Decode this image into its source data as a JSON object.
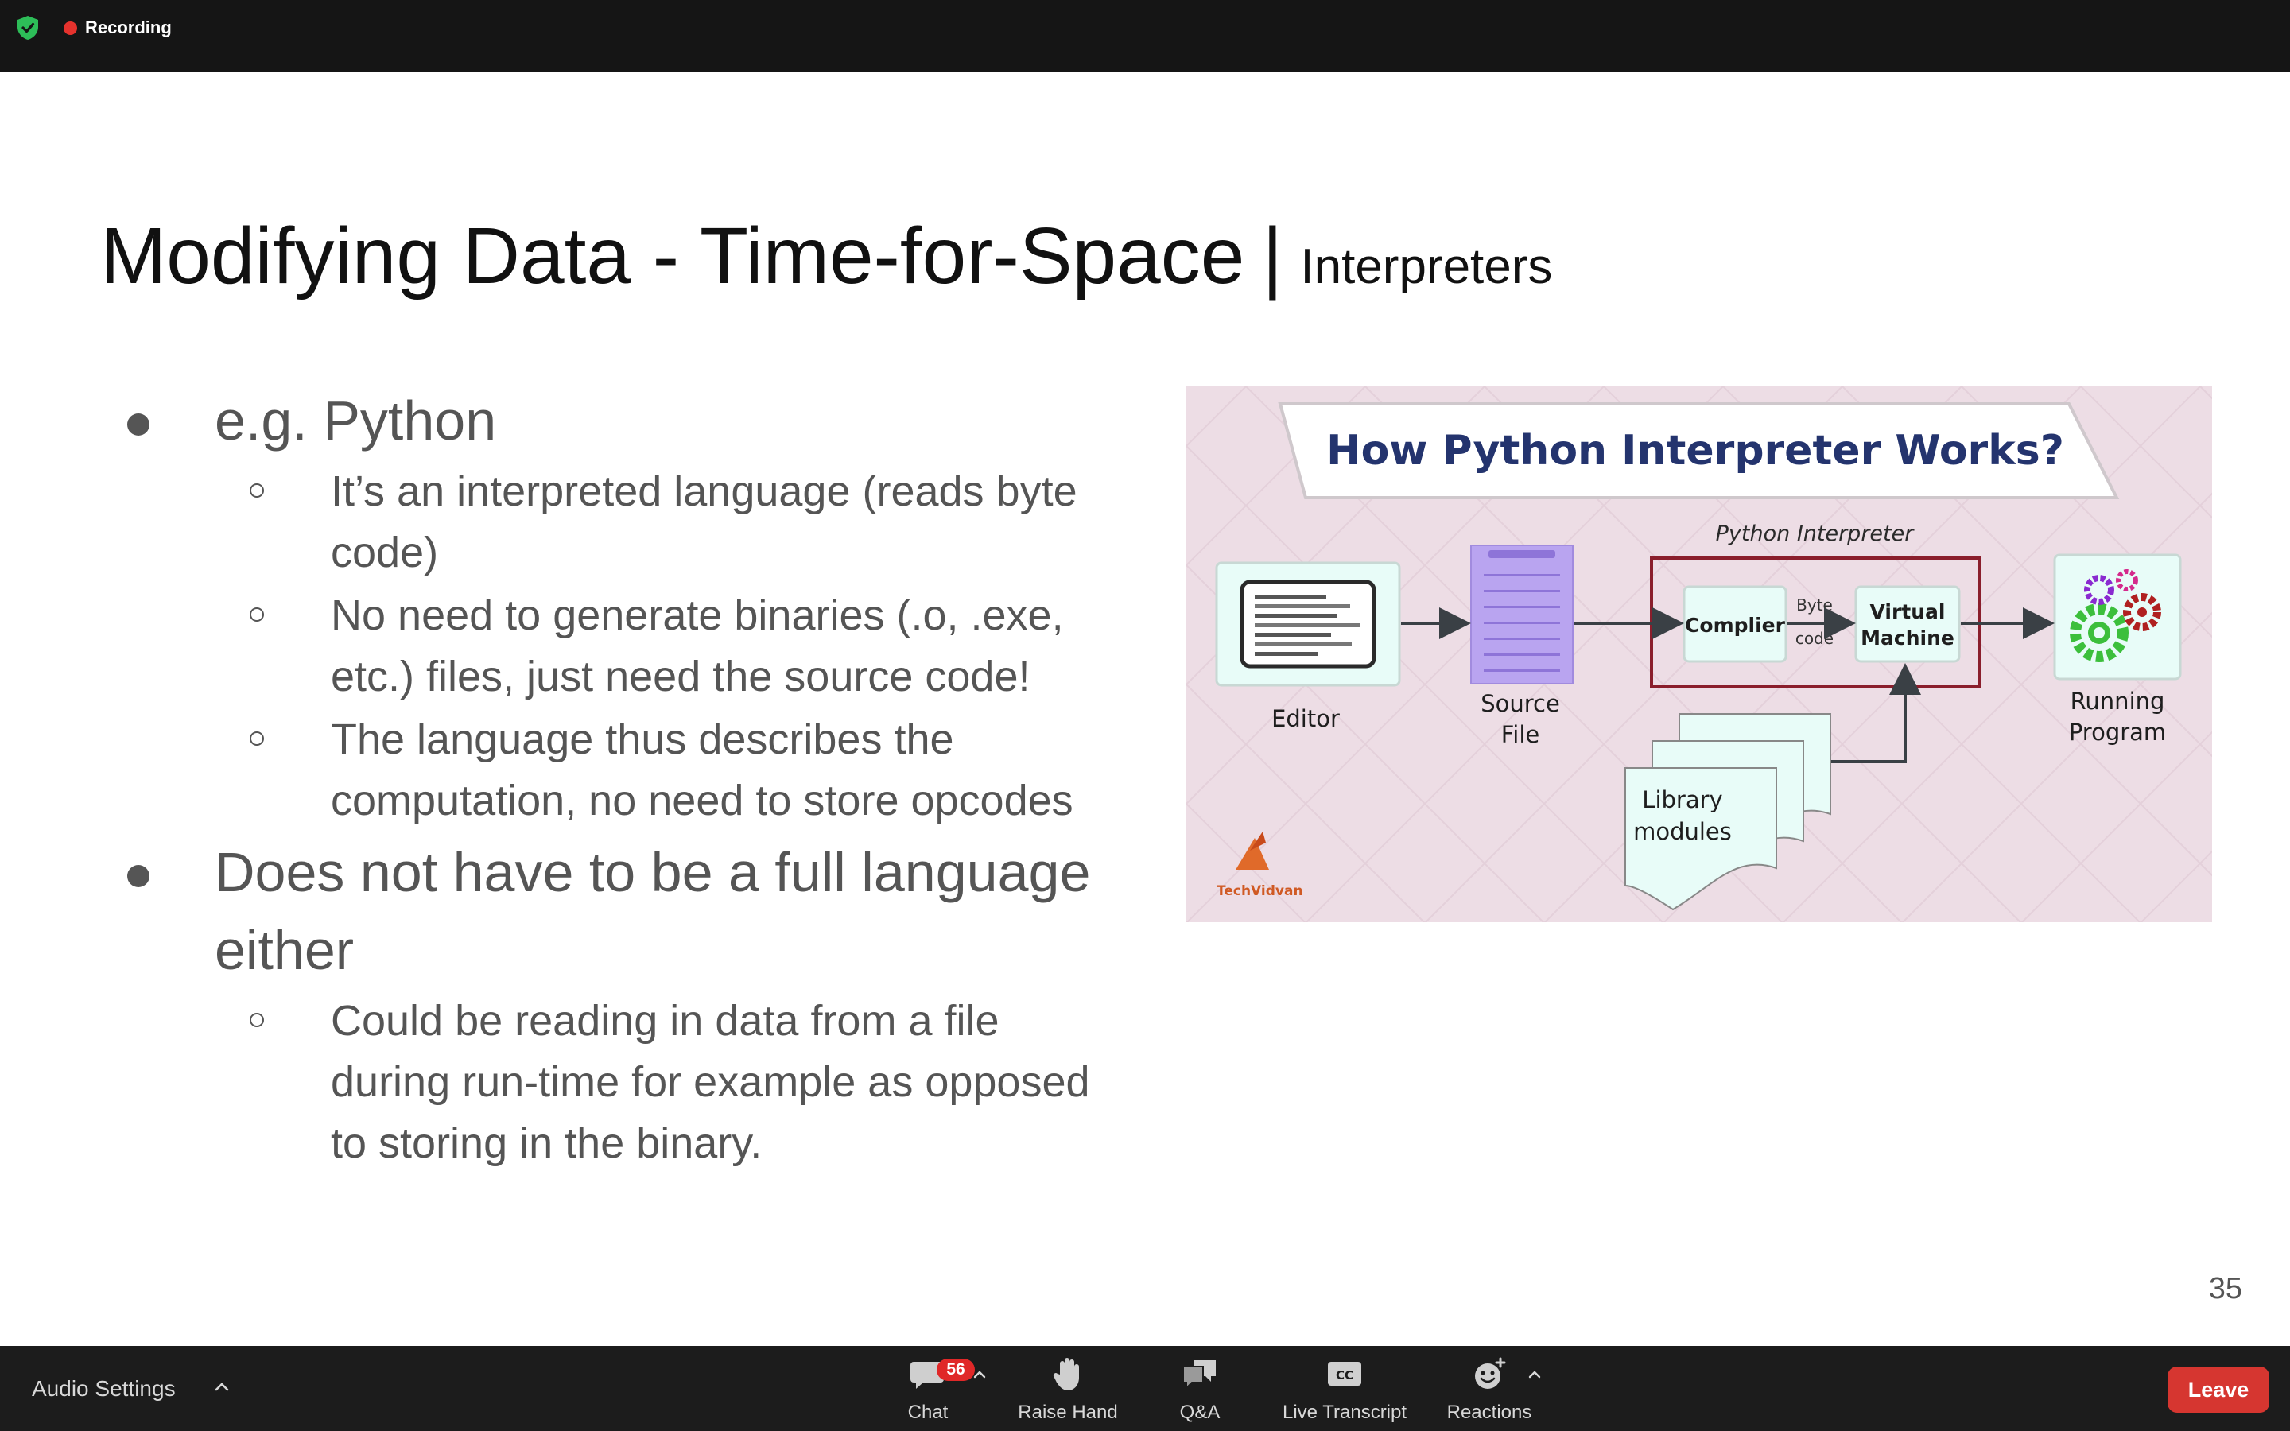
{
  "top_bar": {
    "recording_label": "Recording",
    "colors": {
      "background": "#151515",
      "recording_dot": "#e5322d",
      "shield": "#2dbd58"
    }
  },
  "slide": {
    "title": "Modifying Data - Time-for-Space",
    "title_separator": "|",
    "subtitle": "Interpreters",
    "bullets": [
      {
        "text": "e.g. Python",
        "children": [
          "It’s an interpreted language (reads byte code)",
          "No need to generate binaries (.o, .exe, etc.) files, just need the source code!",
          "The language thus describes the computation, no need to store opcodes"
        ]
      },
      {
        "text": "Does not have to be a full language either",
        "children": [
          "Could be reading in data from a file during run-time for example as opposed to storing in the binary."
        ]
      }
    ],
    "figure": {
      "title": "How Python Interpreter Works?",
      "interpreter_label": "Python Interpreter",
      "editor_label": "Editor",
      "source_file_label": [
        "Source",
        "File"
      ],
      "compiler_label": "Complier",
      "byte_code_label": [
        "Byte",
        "code"
      ],
      "virtual_machine_label": [
        "Virtual",
        "Machine"
      ],
      "library_label": [
        "Library",
        "modules"
      ],
      "running_program_label": [
        "Running",
        "Program"
      ],
      "logo_text": "TechVidvan"
    },
    "page_number": "35"
  },
  "toolbar": {
    "audio_settings": "Audio Settings",
    "chat": "Chat",
    "chat_badge": "56",
    "raise_hand": "Raise Hand",
    "qa": "Q&A",
    "live_transcript": "Live Transcript",
    "cc_icon_text": "CC",
    "reactions": "Reactions",
    "leave": "Leave",
    "colors": {
      "background": "#1c1c1c",
      "leave": "#d63630",
      "badge": "#e02828"
    }
  }
}
